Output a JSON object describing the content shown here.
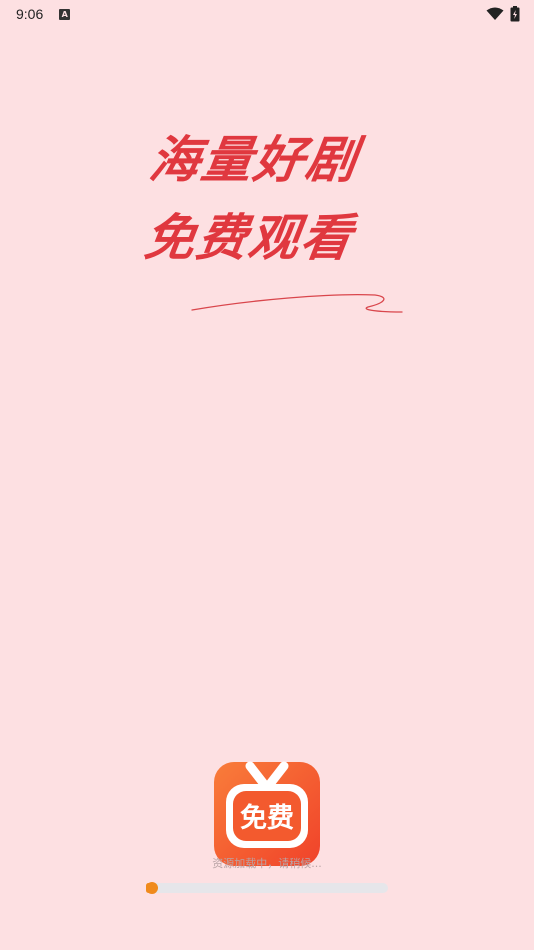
{
  "status_bar": {
    "time": "9:06",
    "notification_icon": "a-icon",
    "wifi_icon": "wifi-icon",
    "battery_icon": "battery-charging-icon"
  },
  "splash": {
    "slogan_line1": "海量好剧",
    "slogan_line2": "免费观看",
    "logo_text": "免费",
    "loading_text": "资源加载中，请稍候...",
    "progress_fraction": 0.02
  },
  "colors": {
    "background": "#fde0e2",
    "slogan": "#e0383f",
    "logo_orange": "#f5692a",
    "progress_accent": "#f08a1c",
    "progress_track": "#e6e6ea"
  }
}
